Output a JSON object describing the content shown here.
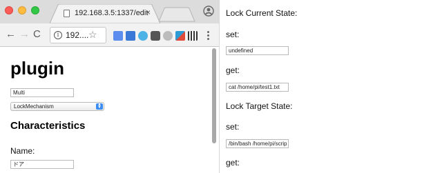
{
  "browser": {
    "tab_title": "192.168.3.5:1337/edit",
    "tab_close": "×",
    "url": "192....",
    "nav_back": "←",
    "nav_forward": "→",
    "nav_reload": "C",
    "info_glyph": "i",
    "star_glyph": "☆"
  },
  "page": {
    "heading": "plugin",
    "name_input_value": "Multi",
    "type_select_value": "LockMechanism",
    "characteristics_heading": "Characteristics",
    "name_label": "Name:",
    "name_value": "ドア"
  },
  "right_panel": {
    "lock_current_state": "Lock Current State:",
    "set_label_1": "set:",
    "set_value_1": "undefined",
    "get_label_1": "get:",
    "get_value_1": "cat /home/pi/test1.txt",
    "lock_target_state": "Lock Target State:",
    "set_label_2": "set:",
    "set_value_2": "/bin/bash /home/pi/scrip",
    "get_label_2": "get:"
  },
  "colors": {
    "window_close": "#fc5b57",
    "window_minimize": "#fdbc40",
    "window_zoom": "#33c748",
    "select_accent": "#3b8df3"
  },
  "icons": {
    "page_icon": "document-icon",
    "profile": "account-circle-icon",
    "menu": "more-vertical-icon"
  }
}
